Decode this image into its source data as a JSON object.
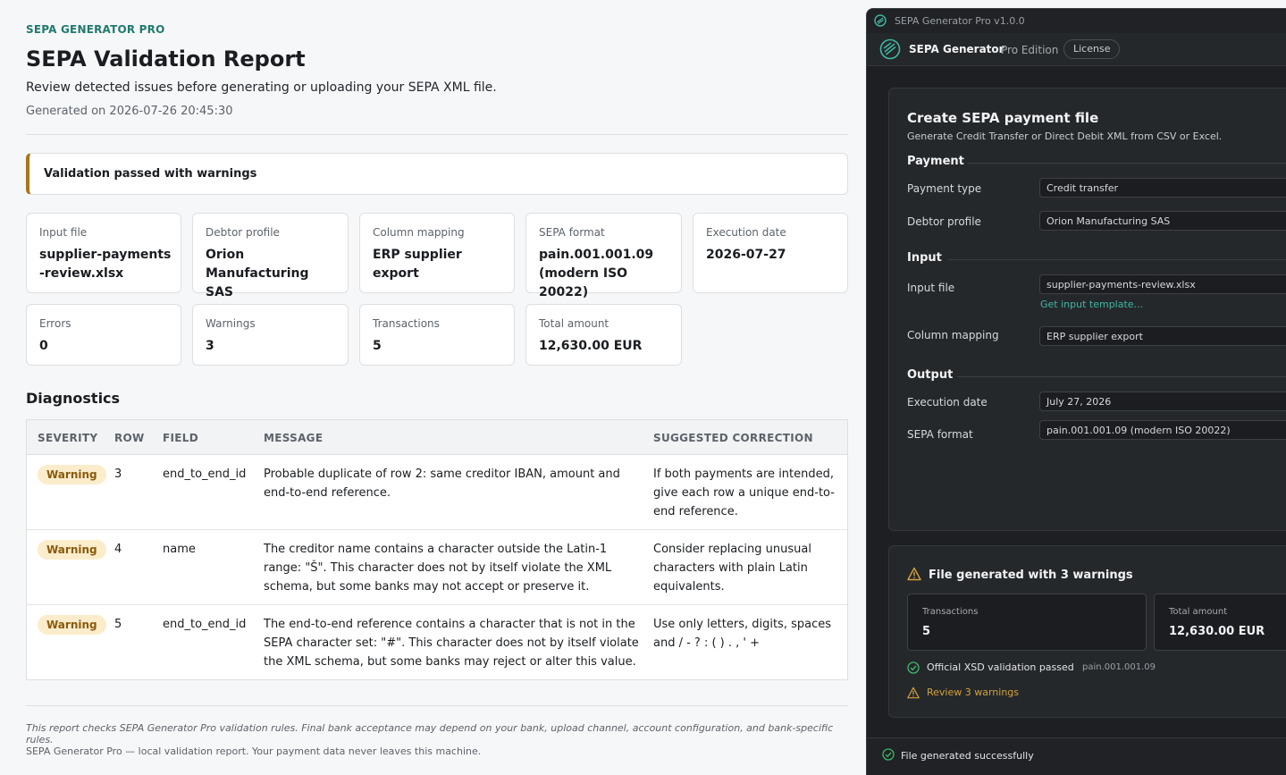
{
  "report": {
    "brand": "SEPA GENERATOR PRO",
    "title": "SEPA Validation Report",
    "subtitle": "Review detected issues before generating or uploading your SEPA XML file.",
    "generated": "Generated on 2026-07-26 20:45:30",
    "banner": "Validation passed with warnings",
    "cards": [
      {
        "label": "Input file",
        "value": "supplier-payments-review.xlsx"
      },
      {
        "label": "Debtor profile",
        "value": "Orion Manufacturing SAS"
      },
      {
        "label": "Column mapping",
        "value": "ERP supplier export"
      },
      {
        "label": "SEPA format",
        "value": "pain.001.001.09 (modern ISO 20022)"
      },
      {
        "label": "Execution date",
        "value": "2026-07-27"
      },
      {
        "label": "Errors",
        "value": "0"
      },
      {
        "label": "Warnings",
        "value": "3"
      },
      {
        "label": "Transactions",
        "value": "5"
      },
      {
        "label": "Total amount",
        "value": "12,630.00 EUR"
      }
    ],
    "diagnostics_title": "Diagnostics",
    "table": {
      "headers": [
        "SEVERITY",
        "ROW",
        "FIELD",
        "MESSAGE",
        "SUGGESTED CORRECTION"
      ],
      "rows": [
        {
          "severity": "Warning",
          "row": "3",
          "field": "end_to_end_id",
          "message": "Probable duplicate of row 2: same creditor IBAN, amount and end-to-end reference.",
          "correction": "If both payments are intended, give each row a unique end-to-end reference."
        },
        {
          "severity": "Warning",
          "row": "4",
          "field": "name",
          "message": "The creditor name contains a character outside the Latin-1 range: \"Š\". This character does not by itself violate the XML schema, but some banks may not accept or preserve it.",
          "correction": "Consider replacing unusual characters with plain Latin equivalents."
        },
        {
          "severity": "Warning",
          "row": "5",
          "field": "end_to_end_id",
          "message": "The end-to-end reference contains a character that is not in the SEPA character set: \"#\". This character does not by itself violate the XML schema, but some banks may reject or alter this value.",
          "correction": "Use only letters, digits, spaces and / - ? : ( ) . , ' +"
        }
      ]
    },
    "disclaimer": "This report checks SEPA Generator Pro validation rules. Final bank acceptance may depend on your bank, upload channel, account configuration, and bank-specific rules.",
    "footer": "SEPA Generator Pro — local validation report. Your payment data never leaves this machine."
  },
  "app": {
    "window_title": "SEPA Generator Pro v1.0.0",
    "app_name": "SEPA Generator",
    "edition": "Pro Edition",
    "license_label": "License",
    "panel": {
      "title": "Create SEPA payment file",
      "subtitle": "Generate Credit Transfer or Direct Debit XML from CSV or Excel.",
      "section_payment": "Payment",
      "payment_type_label": "Payment type",
      "payment_type_value": "Credit transfer",
      "debtor_label": "Debtor profile",
      "debtor_value": "Orion Manufacturing SAS",
      "section_input": "Input",
      "input_file_label": "Input file",
      "input_file_value": "supplier-payments-review.xlsx",
      "template_link": "Get input template...",
      "mapping_label": "Column mapping",
      "mapping_value": "ERP supplier export",
      "section_output": "Output",
      "exec_label": "Execution date",
      "exec_value": "July 27, 2026",
      "format_label": "SEPA format",
      "format_value": "pain.001.001.09 (modern ISO 20022)"
    },
    "result": {
      "title": "File generated with 3 warnings",
      "transactions_label": "Transactions",
      "transactions_value": "5",
      "total_label": "Total amount",
      "total_value": "12,630.00 EUR",
      "xsd_text": "Official XSD validation passed",
      "xsd_format": "pain.001.001.09",
      "review_link": "Review 3 warnings"
    },
    "status": "File generated successfully",
    "colors": {
      "accent": "#3fb8a4",
      "warning": "#d3a13b",
      "success": "#3fb86a",
      "banner_border": "#a8751a"
    }
  }
}
